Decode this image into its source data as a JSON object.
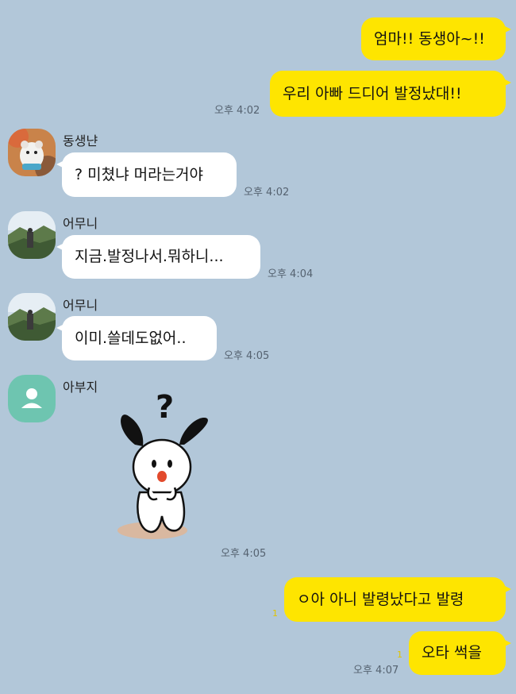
{
  "messages": {
    "m1": {
      "text": "엄마!! 동생아~!!"
    },
    "m2": {
      "text": "우리 아빠 드디어 발정났대!!",
      "time": "오후 4:02"
    },
    "m3": {
      "sender": "동생냔",
      "text": "? 미쳤냐 머라는거야",
      "time": "오후 4:02"
    },
    "m4": {
      "sender": "어무니",
      "text": "지금.발정나서.뭐하니...",
      "time": "오후 4:04"
    },
    "m5": {
      "sender": "어무니",
      "text": "이미.쓸데도없어..",
      "time": "오후 4:05"
    },
    "m6": {
      "sender": "아부지",
      "sticker_mark": "?",
      "time": "오후 4:05"
    },
    "m7": {
      "text": "ㅇ아 아니 발령났다고 발령",
      "unread": "1"
    },
    "m8": {
      "text": "오타 썩을",
      "unread": "1",
      "time": "오후 4:07"
    }
  },
  "colors": {
    "background": "#b2c7d9",
    "outgoing_bubble": "#fee500",
    "incoming_bubble": "#ffffff",
    "default_avatar": "#6ec5b0"
  },
  "icons": {
    "sibling_avatar": "hamster-photo-avatar",
    "mother_avatar": "landscape-photo-avatar",
    "father_avatar": "default-person-avatar",
    "sticker": "rabbit-question-sticker"
  }
}
